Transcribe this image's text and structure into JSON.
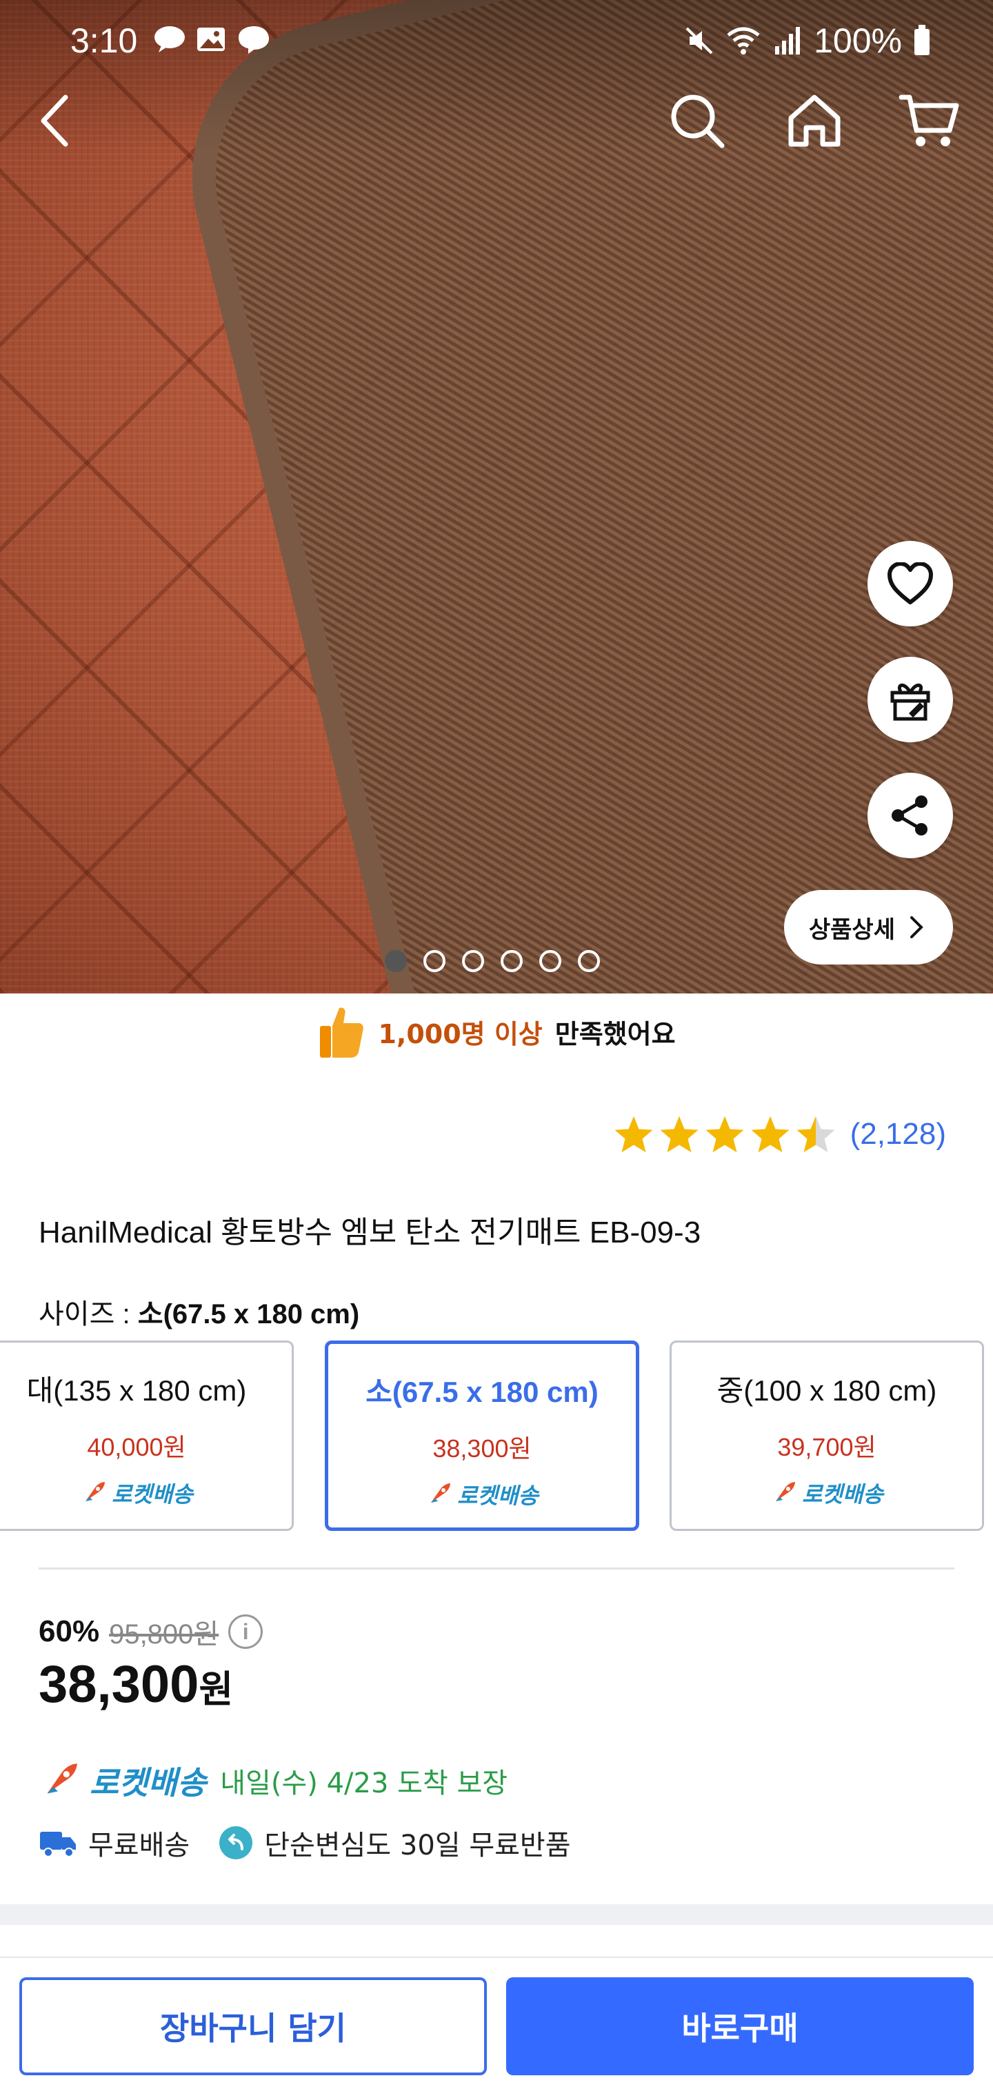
{
  "status_bar": {
    "time": "3:10",
    "battery": "100%"
  },
  "hero": {
    "image_count": 6,
    "active_index": 0,
    "detail_button_label": "상품상세"
  },
  "satisfaction": {
    "highlight": "1,000명 이상",
    "text": "만족했어요"
  },
  "rating": {
    "stars": 4.5,
    "count": "(2,128)"
  },
  "product": {
    "title": "HanilMedical 황토방수 엠보 탄소 전기매트 EB-09-3"
  },
  "size": {
    "label": "사이즈 :",
    "selected": "소(67.5 x 180 cm)",
    "options": [
      {
        "name": "대(135 x 180 cm)",
        "price": "40,000원",
        "shipping": "로켓배송",
        "selected": false
      },
      {
        "name": "소(67.5 x 180 cm)",
        "price": "38,300원",
        "shipping": "로켓배송",
        "selected": true
      },
      {
        "name": "중(100 x 180 cm)",
        "price": "39,700원",
        "shipping": "로켓배송",
        "selected": false
      }
    ]
  },
  "pricing": {
    "discount": "60%",
    "original": "95,800원",
    "price": "38,300",
    "currency": "원"
  },
  "delivery": {
    "type": "로켓배송",
    "eta": "내일(수) 4/23 도착 보장"
  },
  "perks": {
    "free_shipping": "무료배송",
    "free_return": "단순변심도 30일 무료반품"
  },
  "actions": {
    "cart": "장바구니 담기",
    "buy": "바로구매"
  },
  "colors": {
    "accent": "#346aff",
    "price_red": "#c8321e",
    "rocket_blue": "#1f8fc8",
    "eta_green": "#2a9c48",
    "star": "#f5b800"
  }
}
